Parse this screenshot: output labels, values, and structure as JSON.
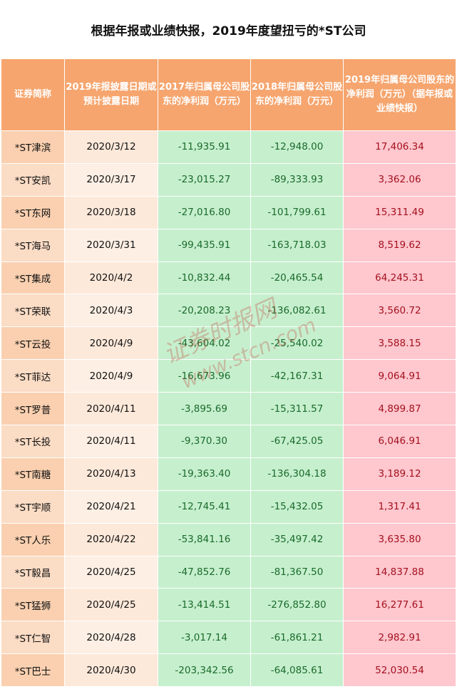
{
  "title": "根据年报或业绩快报，2019年度望扭亏的*ST公司",
  "headers": [
    "证券简称",
    "2019年报披露日期或预计披露日期",
    "2017年归属母公司股东的净利润（万元）",
    "2018年归属母公司股东的净利润（万元）",
    "2019年归属母公司股东的净利润（万元）（据年报或业绩快报）"
  ],
  "rows": [
    {
      "name": "*ST津滨",
      "date": "2020/3/12",
      "p17": "-11,935.91",
      "p18": "-12,948.00",
      "p19": "17,406.34"
    },
    {
      "name": "*ST安凯",
      "date": "2020/3/17",
      "p17": "-23,015.27",
      "p18": "-89,333.93",
      "p19": "3,362.06"
    },
    {
      "name": "*ST东网",
      "date": "2020/3/18",
      "p17": "-27,016.80",
      "p18": "-101,799.61",
      "p19": "15,311.49"
    },
    {
      "name": "*ST海马",
      "date": "2020/3/31",
      "p17": "-99,435.91",
      "p18": "-163,718.03",
      "p19": "8,519.62"
    },
    {
      "name": "*ST集成",
      "date": "2020/4/2",
      "p17": "-10,832.44",
      "p18": "-20,465.54",
      "p19": "64,245.31"
    },
    {
      "name": "*ST荣联",
      "date": "2020/4/3",
      "p17": "-20,208.23",
      "p18": "-136,082.61",
      "p19": "3,560.72"
    },
    {
      "name": "*ST云投",
      "date": "2020/4/9",
      "p17": "-43,604.02",
      "p18": "-25,540.02",
      "p19": "3,588.15"
    },
    {
      "name": "*ST菲达",
      "date": "2020/4/9",
      "p17": "-16,673.96",
      "p18": "-42,167.31",
      "p19": "9,064.91"
    },
    {
      "name": "*ST罗普",
      "date": "2020/4/11",
      "p17": "-3,895.69",
      "p18": "-15,311.57",
      "p19": "4,899.87"
    },
    {
      "name": "*ST长投",
      "date": "2020/4/11",
      "p17": "-9,370.30",
      "p18": "-67,425.05",
      "p19": "6,046.91"
    },
    {
      "name": "*ST南糖",
      "date": "2020/4/13",
      "p17": "-19,363.40",
      "p18": "-136,304.18",
      "p19": "3,189.12"
    },
    {
      "name": "*ST宇顺",
      "date": "2020/4/21",
      "p17": "-12,745.41",
      "p18": "-15,432.05",
      "p19": "1,317.41"
    },
    {
      "name": "*ST人乐",
      "date": "2020/4/22",
      "p17": "-53,841.16",
      "p18": "-35,497.42",
      "p19": "3,635.80"
    },
    {
      "name": "*ST毅昌",
      "date": "2020/4/25",
      "p17": "-47,852.76",
      "p18": "-81,367.50",
      "p19": "14,837.88"
    },
    {
      "name": "*ST猛狮",
      "date": "2020/4/25",
      "p17": "-13,414.51",
      "p18": "-276,852.80",
      "p19": "16,277.61"
    },
    {
      "name": "*ST仁智",
      "date": "2020/4/28",
      "p17": "-3,017.14",
      "p18": "-61,861.21",
      "p19": "2,982.91"
    },
    {
      "name": "*ST巴士",
      "date": "2020/4/30",
      "p17": "-203,342.56",
      "p18": "-64,085.61",
      "p19": "52,030.54"
    }
  ],
  "watermark": {
    "line1": "证券时报网",
    "line2": "www.stcn.com"
  },
  "colors": {
    "header_bg": "#f6a56e",
    "name_bg": "#fad0b0",
    "date_bg": "#fde9da",
    "loss_bg": "#c6efce",
    "loss_text": "#1a6b2a",
    "profit_bg": "#ffc7ce",
    "profit_text": "#a3101e"
  }
}
